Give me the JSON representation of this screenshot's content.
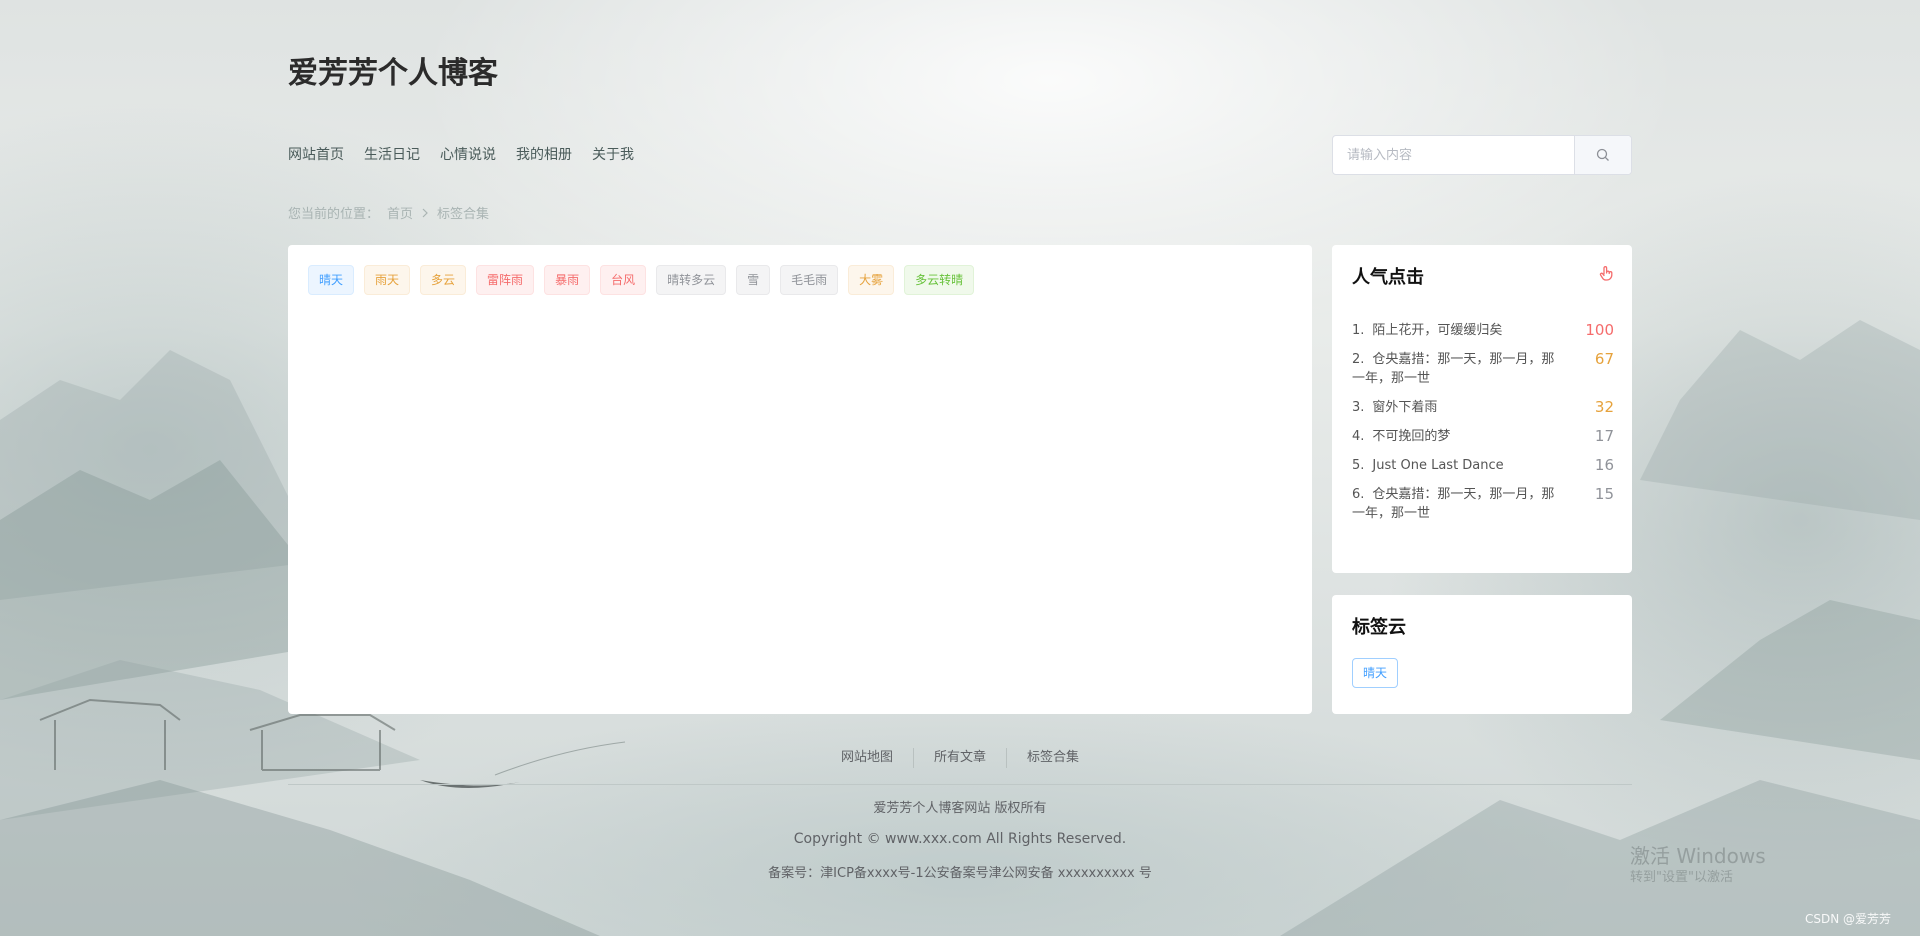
{
  "site": {
    "title": "爱芳芳个人博客"
  },
  "nav": {
    "items": [
      {
        "label": "网站首页"
      },
      {
        "label": "生活日记"
      },
      {
        "label": "心情说说"
      },
      {
        "label": "我的相册"
      },
      {
        "label": "关于我"
      }
    ]
  },
  "search": {
    "placeholder": "请输入内容",
    "icon": "search-icon"
  },
  "breadcrumb": {
    "prefix": "您当前的位置：",
    "home": "首页",
    "separator_icon": "chevron-right-icon",
    "current": "标签合集"
  },
  "tags": [
    {
      "label": "晴天",
      "type": "blue"
    },
    {
      "label": "雨天",
      "type": "orange"
    },
    {
      "label": "多云",
      "type": "orange"
    },
    {
      "label": "雷阵雨",
      "type": "red"
    },
    {
      "label": "暴雨",
      "type": "red"
    },
    {
      "label": "台风",
      "type": "red"
    },
    {
      "label": "晴转多云",
      "type": "gray"
    },
    {
      "label": "雪",
      "type": "gray"
    },
    {
      "label": "毛毛雨",
      "type": "gray"
    },
    {
      "label": "大雾",
      "type": "orange"
    },
    {
      "label": "多云转晴",
      "type": "green"
    }
  ],
  "popular": {
    "title": "人气点击",
    "icon": "pointer-hand-icon",
    "items": [
      {
        "rank": "1.",
        "title": "陌上花开，可缓缓归矣",
        "count": "100",
        "color": "#f56c6c"
      },
      {
        "rank": "2.",
        "title": "仓央嘉措：那一天，那一月，那一年，那一世",
        "count": "67",
        "color": "#e6a23c"
      },
      {
        "rank": "3.",
        "title": "窗外下着雨",
        "count": "32",
        "color": "#e6a23c"
      },
      {
        "rank": "4.",
        "title": "不可挽回的梦",
        "count": "17",
        "color": "#909399"
      },
      {
        "rank": "5.",
        "title": "Just One Last Dance",
        "count": "16",
        "color": "#909399"
      },
      {
        "rank": "6.",
        "title": "仓央嘉措：那一天，那一月，那一年，那一世",
        "count": "15",
        "color": "#909399"
      }
    ]
  },
  "tagcloud": {
    "title": "标签云",
    "tag": "晴天"
  },
  "footer": {
    "links": [
      "网站地图",
      "所有文章",
      "标签合集"
    ],
    "owner": "爱芳芳个人博客网站 版权所有",
    "copyright": "Copyright © www.xxx.com All Rights Reserved.",
    "icp": "备案号：津ICP备xxxx号-1公安备案号津公网安备 xxxxxxxxxx 号"
  },
  "overlay": {
    "activate_title": "激活 Windows",
    "activate_hint": "转到\"设置\"以激活",
    "csdn": "CSDN @爱芳芳"
  }
}
